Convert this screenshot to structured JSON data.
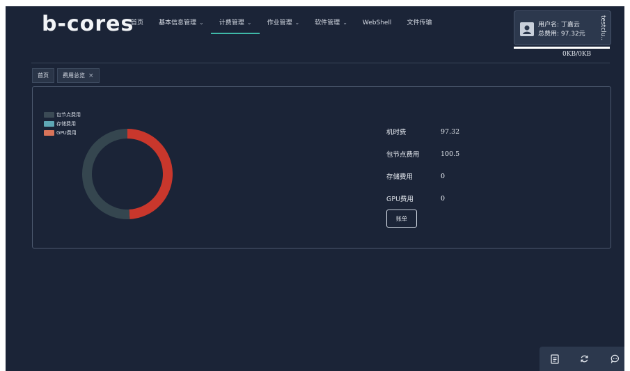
{
  "app": {
    "logo": "b-cores"
  },
  "nav": [
    {
      "label": "首页",
      "chevron": false
    },
    {
      "label": "基本信息管理",
      "chevron": true
    },
    {
      "label": "计费管理",
      "chevron": true,
      "active": true
    },
    {
      "label": "作业管理",
      "chevron": true
    },
    {
      "label": "软件管理",
      "chevron": true
    },
    {
      "label": "WebShell",
      "chevron": false
    },
    {
      "label": "文件传输",
      "chevron": false
    }
  ],
  "user": {
    "username_label": "用户名:",
    "username": "丁嘉云",
    "total_cost_label": "总费用:",
    "total_cost": "97.32元",
    "vertical_text": "testclu..."
  },
  "traffic": {
    "text": "0KB/0KB"
  },
  "tabs": [
    {
      "label": "首页",
      "closable": false
    },
    {
      "label": "费用总览",
      "closable": true
    }
  ],
  "legend": [
    {
      "label": "包节点费用",
      "color": "#3b4a55"
    },
    {
      "label": "存储费用",
      "color": "#5fa8b5"
    },
    {
      "label": "GPU费用",
      "color": "#d9745a"
    }
  ],
  "chart_data": {
    "type": "pie",
    "style": "donut",
    "slices": [
      {
        "label": "机时费",
        "value": 97.32,
        "color": "#c9372c"
      },
      {
        "label": "包节点费用",
        "value": 100.5,
        "color": "#35464f"
      },
      {
        "label": "存储费用",
        "value": 0,
        "color": "#5fa8b5"
      },
      {
        "label": "GPU费用",
        "value": 0,
        "color": "#d9745a"
      }
    ]
  },
  "stats": [
    {
      "label": "机时费",
      "value": "97.32"
    },
    {
      "label": "包节点费用",
      "value": "100.5"
    },
    {
      "label": "存储费用",
      "value": "0"
    },
    {
      "label": "GPU费用",
      "value": "0"
    }
  ],
  "bill_button": "账单",
  "toolbar": [
    {
      "icon": "document-icon"
    },
    {
      "icon": "refresh-icon"
    },
    {
      "icon": "chat-icon"
    }
  ]
}
